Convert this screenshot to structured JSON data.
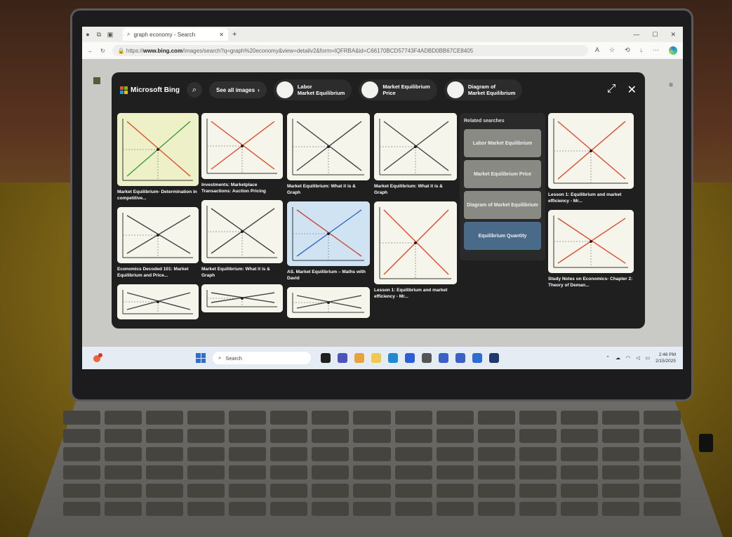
{
  "browser": {
    "tab_title": "graph economy - Search",
    "url_prefix": "https://",
    "url_domain": "www.bing.com",
    "url_rest": "/images/search?q=graph%20economy&view=detailv2&form=IQFRBA&id=C66170BCD57743F4ADBD0BB67CE8405",
    "icons": [
      "profile-icon",
      "workspaces-icon",
      "tab-actions-icon",
      "new-tab-icon",
      "back-icon",
      "refresh-icon",
      "read-aloud-icon",
      "favorite-icon",
      "extensions-icon",
      "downloads-icon",
      "more-icon"
    ]
  },
  "viewer": {
    "brand": "Microsoft Bing",
    "see_all": "See all images",
    "see_all_arrow": "›",
    "chips": [
      {
        "line1": "Labor",
        "line2": "Market Equilibrium"
      },
      {
        "line1": "Market Equilibrium",
        "line2": "Price"
      },
      {
        "line1": "Diagram of",
        "line2": "Market Equilibrium"
      }
    ],
    "expand_icon": "⤢",
    "close_icon": "✕",
    "columns": [
      [
        {
          "caption": "Market Equilibrium- Determination in competitive...",
          "style": "green"
        },
        {
          "caption": "Economics Decoded 101: Market Equilibrium and Price...",
          "style": "plain"
        },
        {
          "caption": "",
          "style": "plain"
        }
      ],
      [
        {
          "caption": "Investments: Marketplace Transactions: Auction Pricing",
          "style": "red"
        },
        {
          "caption": "Market Equilibrium: What it is & Graph",
          "style": "plain"
        },
        {
          "caption": "",
          "style": "plain"
        }
      ],
      [
        {
          "caption": "Market Equilibrium: What it is & Graph",
          "style": "plain"
        },
        {
          "caption": "AS. Market Equilibrium – Maths with David",
          "style": "blue"
        },
        {
          "caption": "",
          "style": "plain"
        }
      ],
      [
        {
          "caption": "Market Equilibrium: What it is & Graph",
          "style": "plain"
        },
        {
          "caption": "Lesson 1: Equilibrium and market efficiency - Mr...",
          "style": "red"
        }
      ],
      [
        {
          "caption": "Lesson 1: Equilibrium and market efficiency - Mr...",
          "style": "red"
        },
        {
          "caption": "Study Notes on Economics- Chapter 2: Theory of Deman...",
          "style": "red"
        }
      ]
    ],
    "related_title": "Related searches",
    "related": [
      "Labor Market Equilibrium",
      "Market Equilibrium Price",
      "Diagram of Market Equilibrium",
      "Equilibrium Quantity"
    ]
  },
  "taskbar": {
    "search_label": "Search",
    "time": "2:46 PM",
    "date": "2/15/2025",
    "app_colors": [
      "#202020",
      "#4b53bc",
      "#e8a23a",
      "#f2c94c",
      "#1f8bd6",
      "#2b5fd9",
      "#555555",
      "#3a5fc8",
      "#3a5fc8",
      "#2b6cd6",
      "#1d3a6a"
    ],
    "app_icons": [
      "task-view-icon",
      "teams-icon",
      "copilot-icon",
      "file-explorer-icon",
      "edge-icon",
      "store-icon",
      "dell-icon",
      "app-icon-1",
      "app-icon-2",
      "app-icon-3",
      "app-icon-4"
    ],
    "tray_icons": [
      "chevron-up-icon",
      "onedrive-icon",
      "wifi-icon",
      "volume-icon",
      "battery-icon"
    ]
  }
}
